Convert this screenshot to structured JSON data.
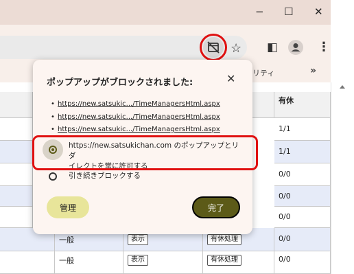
{
  "window": {
    "minimize_glyph": "−",
    "maximize_glyph": "☐",
    "close_glyph": "✕"
  },
  "toolbar": {
    "popup_blocked_icon": "popup-blocked-icon",
    "star_icon": "☆",
    "sidepanel_icon": "◧",
    "profile_icon": "👤",
    "menu_icon": "⋮"
  },
  "bookmarks": {
    "partial_label": "リティ",
    "overflow": "»"
  },
  "table": {
    "header_right": "有休",
    "rows": [
      {
        "col1": "",
        "col2": "",
        "col3": "",
        "value": "1/1"
      },
      {
        "col1": "",
        "col2": "",
        "col3": "",
        "value": "1/1"
      },
      {
        "col1": "",
        "col2": "",
        "col3": "",
        "value": "0/0"
      },
      {
        "col1": "",
        "col2": "",
        "col3": "",
        "value": "0/0"
      },
      {
        "col1": "",
        "col2": "",
        "col3": "",
        "value": "0/0"
      },
      {
        "col1": "一般",
        "col2": "表示",
        "col3": "有休処理",
        "value": "0/0"
      },
      {
        "col1": "一般",
        "col2": "表示",
        "col3": "有休処理",
        "value": "0/0"
      }
    ]
  },
  "popup": {
    "title": "ポップアップがブロックされました:",
    "close": "✕",
    "links": [
      "https://new.satsukic.../TimeManagersHtml.aspx",
      "https://new.satsukic.../TimeManagersHtml.aspx",
      "https://new.satsukic.../TimeManagersHtml.aspx"
    ],
    "option_allow_line1": "https://new.satsukichan.com のポップアップとリダ",
    "option_allow_line2": "イレクトを常に許可する",
    "option_block": "引き続きブロックする",
    "manage_label": "管理",
    "done_label": "完了"
  },
  "colors": {
    "accent": "#5c5a18",
    "highlight": "#e01010",
    "manage_bg": "#e8e59a"
  }
}
